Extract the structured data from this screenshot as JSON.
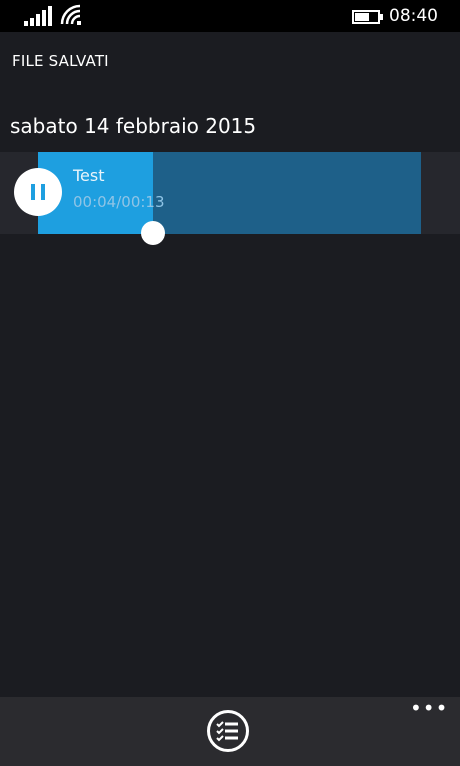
{
  "status_bar": {
    "time": "08:40",
    "icons": [
      "signal-icon",
      "wifi-icon",
      "battery-icon"
    ]
  },
  "app": {
    "title": "FILE SALVATI"
  },
  "recordings": {
    "date_header": "sabato 14 febbraio 2015",
    "items": [
      {
        "name": "Test",
        "time": "00:04/00:13",
        "playback_fraction": 0.3,
        "state_icon": "pause-icon"
      }
    ]
  },
  "app_bar": {
    "more_label": "•••",
    "icons": [
      "checklist-icon",
      "more-icon"
    ]
  },
  "colors": {
    "accent": "#1e9fe0",
    "track": "#1e6089",
    "background": "#1b1c21"
  }
}
